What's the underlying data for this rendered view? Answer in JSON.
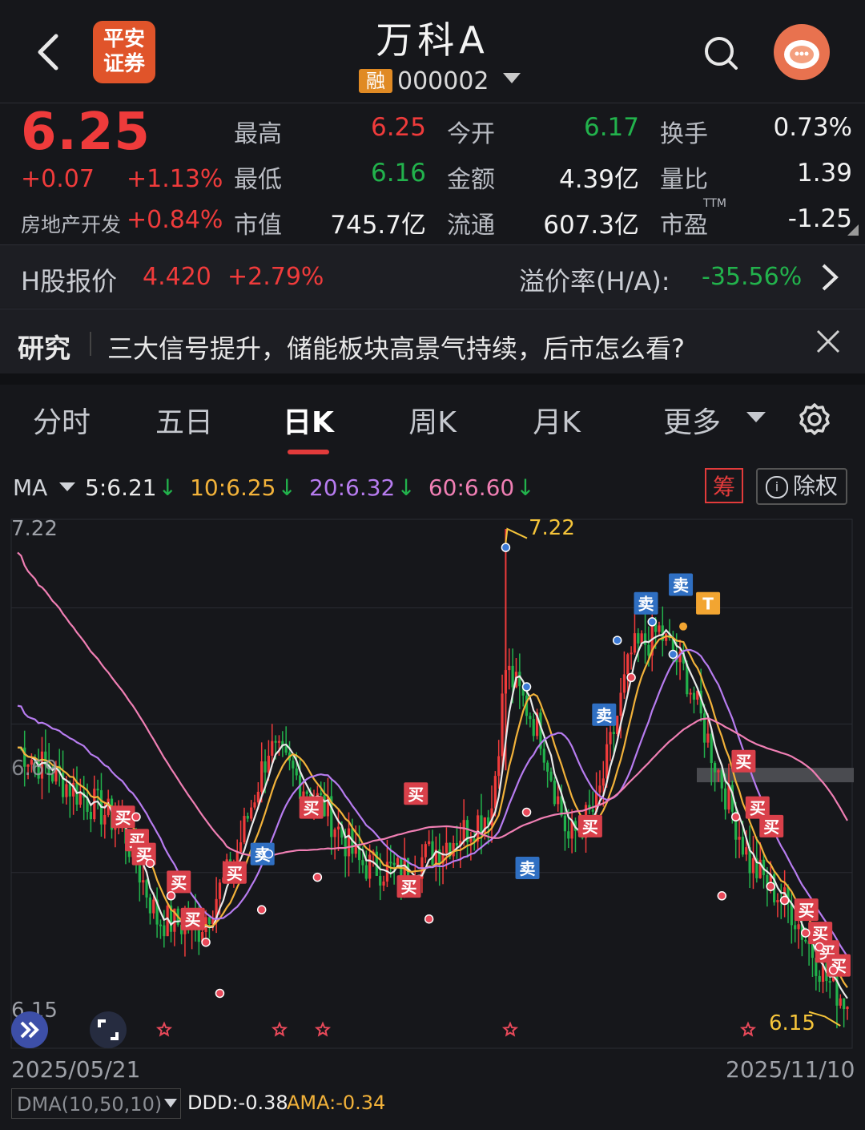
{
  "header": {
    "title": "万科A",
    "broker_logo": "平安证券",
    "margin_badge": "融",
    "code": "000002"
  },
  "quote": {
    "price": "6.25",
    "change": "+0.07",
    "change_pct": "+1.13%",
    "sector_name": "房地产开发",
    "sector_pct": "+0.84%",
    "stats": [
      {
        "label": "最高",
        "value": "6.25",
        "tone": "red"
      },
      {
        "label": "今开",
        "value": "6.17",
        "tone": "green"
      },
      {
        "label": "换手",
        "value": "0.73%",
        "tone": "white"
      },
      {
        "label": "最低",
        "value": "6.16",
        "tone": "green"
      },
      {
        "label": "金额",
        "value": "4.39亿",
        "tone": "white"
      },
      {
        "label": "量比",
        "value": "1.39",
        "tone": "white"
      },
      {
        "label": "市值",
        "value": "745.7亿",
        "tone": "white"
      },
      {
        "label": "流通",
        "value": "607.3亿",
        "tone": "white"
      },
      {
        "label": "市盈",
        "value": "-1.25",
        "tone": "white"
      }
    ],
    "pe_superscript": "TTM"
  },
  "hshare": {
    "label": "H股报价",
    "price": "4.420",
    "pct": "+2.79%",
    "premium_label": "溢价率(H/A):",
    "premium": "-35.56%"
  },
  "research": {
    "tag": "研究",
    "headline": "三大信号提升，储能板块高景气持续，后市怎么看?"
  },
  "tabs": [
    "分时",
    "五日",
    "日K",
    "周K",
    "月K",
    "更多"
  ],
  "active_tab": "日K",
  "ma_row": {
    "label": "MA",
    "items": [
      {
        "text": "5:6.21",
        "color": "#e9e9e9"
      },
      {
        "text": "10:6.25",
        "color": "#f2b23a"
      },
      {
        "text": "20:6.32",
        "color": "#b77cf0"
      },
      {
        "text": "60:6.60",
        "color": "#f07fb4"
      }
    ],
    "chou": "筹",
    "chuquan": "除权"
  },
  "chart_data": {
    "type": "candlestick",
    "y_top_label": "7.22",
    "y_bottom_label": "6.15",
    "ylim": [
      6.15,
      7.22
    ],
    "high_marker": "7.22",
    "low_marker": "6.15",
    "x_start": "2025/05/21",
    "x_end": "2025/11/10",
    "price_line": "6.69",
    "signals": [
      {
        "text": "买",
        "kind": "buy"
      },
      {
        "text": "卖",
        "kind": "sell"
      },
      {
        "text": "T",
        "kind": "t"
      }
    ]
  },
  "indicator": {
    "name": "DMA(10,50,10)",
    "ddd": "DDD:-0.38",
    "ama": "AMA:-0.34"
  },
  "colors": {
    "up": "#ef3b3b",
    "down": "#22b24c",
    "ma5": "#e9e9e9",
    "ma10": "#f2b23a",
    "ma20": "#b77cf0",
    "ma60": "#f07fb4"
  }
}
